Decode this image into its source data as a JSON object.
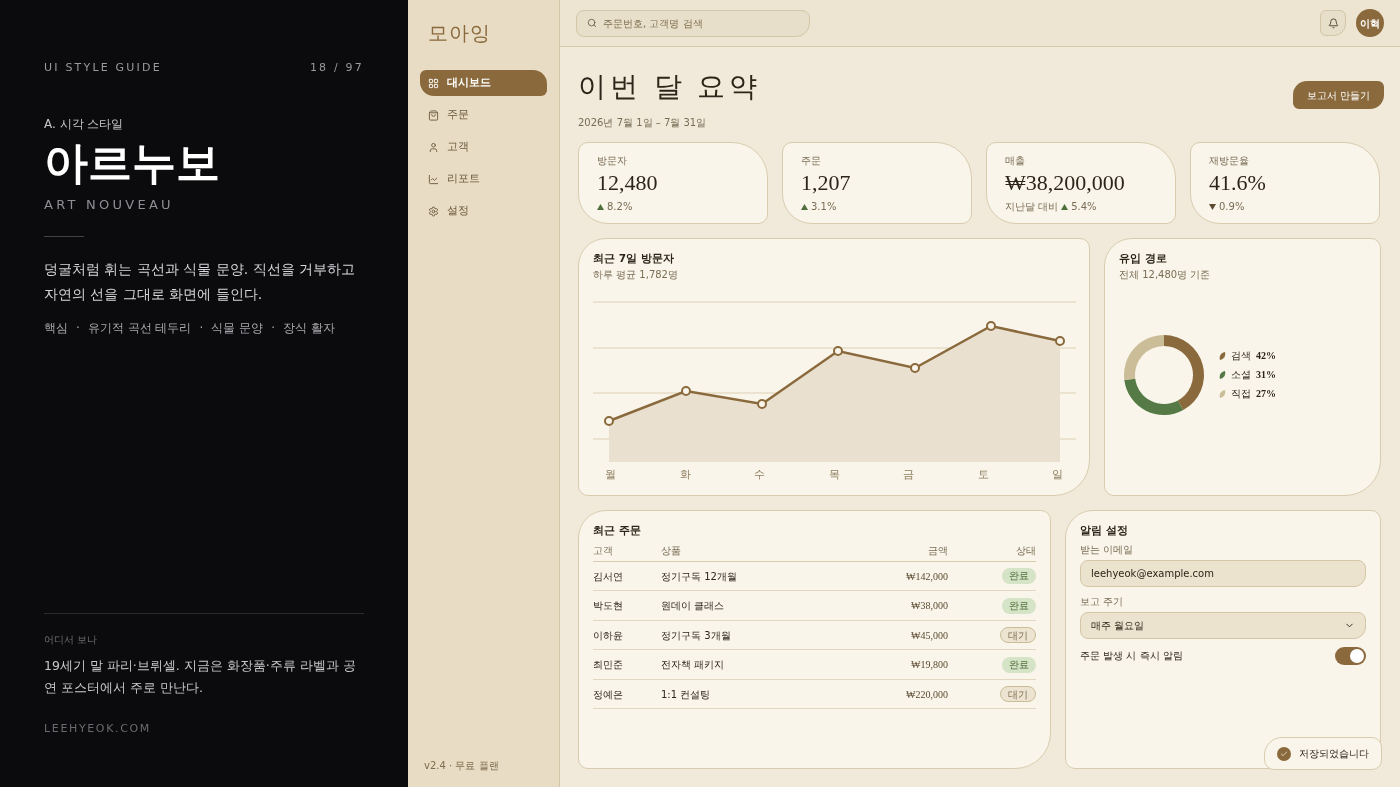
{
  "guide": {
    "label": "UI STYLE GUIDE",
    "page": "18 / 97",
    "section": "A. 시각 스타일",
    "title": "아르누보",
    "subtitle": "ART NOUVEAU",
    "description": "덩굴처럼 휘는 곡선과 식물 문양. 직선을 거부하고 자연의 선을 그대로 화면에 들인다.",
    "keywords": [
      "핵심",
      "·",
      "유기적 곡선 테두리",
      "·",
      "식물 문양",
      "·",
      "장식 활자"
    ],
    "where_label": "어디서 보나",
    "where_text": "19세기 말 파리·브뤼셀. 지금은 화장품·주류 라벨과 공연 포스터에서 주로 만난다.",
    "site": "LEEHYEOK.COM"
  },
  "app": {
    "logo": "모아잉",
    "nav": [
      {
        "label": "대시보드",
        "selected": true
      },
      {
        "label": "주문",
        "selected": false
      },
      {
        "label": "고객",
        "selected": false
      },
      {
        "label": "리포트",
        "selected": false
      },
      {
        "label": "설정",
        "selected": false
      }
    ],
    "version": "v2.4 · 무료 플랜",
    "search": {
      "placeholder": "주문번호, 고객명 검색"
    },
    "avatar": "이혁",
    "heading": "이번 달 요약",
    "period": "2026년 7월 1일 – 7월 31일",
    "report_button": "보고서 만들기",
    "kpis": [
      {
        "label": "방문자",
        "value": "12,480",
        "kind": "up",
        "change": "8.2%"
      },
      {
        "label": "주문",
        "value": "1,207",
        "kind": "up",
        "change": "3.1%"
      },
      {
        "label": "매출",
        "value": "₩38,200,000",
        "prefix": "지난달 대비",
        "kind": "up",
        "change": "5.4%"
      },
      {
        "label": "재방문율",
        "value": "41.6%",
        "kind": "down",
        "change": "0.9%"
      }
    ],
    "visitors": {
      "title": "최근 7일 방문자",
      "subtitle": "하루 평균 1,782명",
      "days": [
        "월",
        "화",
        "수",
        "목",
        "금",
        "토",
        "일"
      ]
    },
    "sources": {
      "title": "유입 경로",
      "subtitle": "전체 12,480명 기준",
      "chart_data": {
        "type": "donut",
        "categories": [
          "검색",
          "소셜",
          "직접"
        ],
        "values": [
          42,
          31,
          27
        ]
      },
      "legend": [
        {
          "value": "42%",
          "color": "#8a6a3c"
        },
        {
          "value": "31%",
          "color": "#557a45"
        },
        {
          "value": "27%",
          "color": "#cbbd98"
        }
      ]
    },
    "orders": {
      "title": "최근 주문",
      "columns": [
        "고객",
        "상품",
        "금액",
        "상태"
      ],
      "rows": [
        {
          "customer": "김서연",
          "product": "정기구독 12개월",
          "amount": "₩142,000",
          "status": "완료",
          "kind": "done"
        },
        {
          "customer": "박도현",
          "product": "원데이 클래스",
          "amount": "₩38,000",
          "status": "완료",
          "kind": "done"
        },
        {
          "customer": "이하윤",
          "product": "정기구독 3개월",
          "amount": "₩45,000",
          "status": "대기",
          "kind": "pending"
        },
        {
          "customer": "최민준",
          "product": "전자책 패키지",
          "amount": "₩19,800",
          "status": "완료",
          "kind": "done"
        },
        {
          "customer": "정예은",
          "product": "1:1 컨설팅",
          "amount": "₩220,000",
          "status": "대기",
          "kind": "pending"
        }
      ]
    },
    "alerts": {
      "title": "알림 설정",
      "email_label": "받는 이메일",
      "email": "leehyeok@example.com",
      "cycle_label": "보고 주기",
      "cycle": "매주 월요일",
      "toggle_label": "주문 발생 시 즉시 알림",
      "toggle_on": true
    },
    "toast": "저장되었습니다"
  }
}
